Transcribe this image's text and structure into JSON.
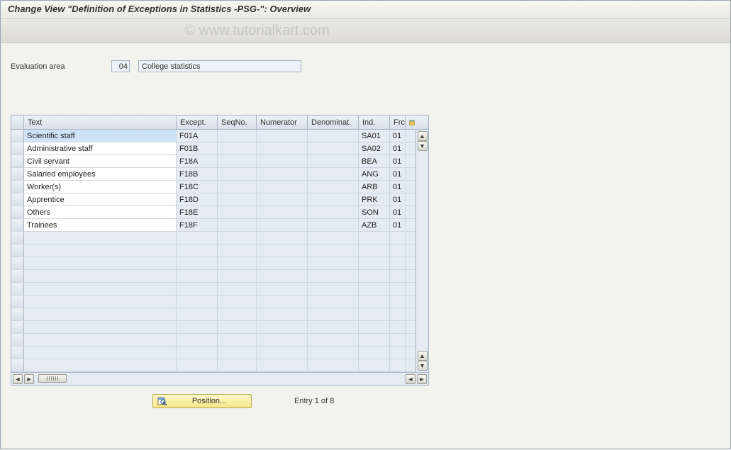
{
  "title": "Change View \"Definition of Exceptions in Statistics -PSG-\": Overview",
  "watermark": "© www.tutorialkart.com",
  "evaluation": {
    "label": "Evaluation area",
    "code": "04",
    "description": "College statistics"
  },
  "columns": {
    "text": "Text",
    "except": "Except.",
    "seqno": "SeqNo.",
    "numerator": "Numerator",
    "denominat": "Denominat.",
    "ind": "Ind.",
    "frc": "Frc"
  },
  "rows": [
    {
      "text": "Scientific staff",
      "except": "F01A",
      "seqno": "",
      "numerator": "",
      "denominat": "",
      "ind": "SA01",
      "frc": "01",
      "selected": true
    },
    {
      "text": "Administrative staff",
      "except": "F01B",
      "seqno": "",
      "numerator": "",
      "denominat": "",
      "ind": "SA02",
      "frc": "01"
    },
    {
      "text": "Civil servant",
      "except": "F18A",
      "seqno": "",
      "numerator": "",
      "denominat": "",
      "ind": "BEA",
      "frc": "01"
    },
    {
      "text": "Salaried employees",
      "except": "F18B",
      "seqno": "",
      "numerator": "",
      "denominat": "",
      "ind": "ANG",
      "frc": "01"
    },
    {
      "text": "Worker(s)",
      "except": "F18C",
      "seqno": "",
      "numerator": "",
      "denominat": "",
      "ind": "ARB",
      "frc": "01"
    },
    {
      "text": "Apprentice",
      "except": "F18D",
      "seqno": "",
      "numerator": "",
      "denominat": "",
      "ind": "PRK",
      "frc": "01"
    },
    {
      "text": "Others",
      "except": "F18E",
      "seqno": "",
      "numerator": "",
      "denominat": "",
      "ind": "SON",
      "frc": "01"
    },
    {
      "text": "Trainees",
      "except": "F18F",
      "seqno": "",
      "numerator": "",
      "denominat": "",
      "ind": "AZB",
      "frc": "01"
    }
  ],
  "empty_row_count": 11,
  "footer": {
    "position_label": "Position...",
    "entry_label": "Entry 1 of 8"
  }
}
